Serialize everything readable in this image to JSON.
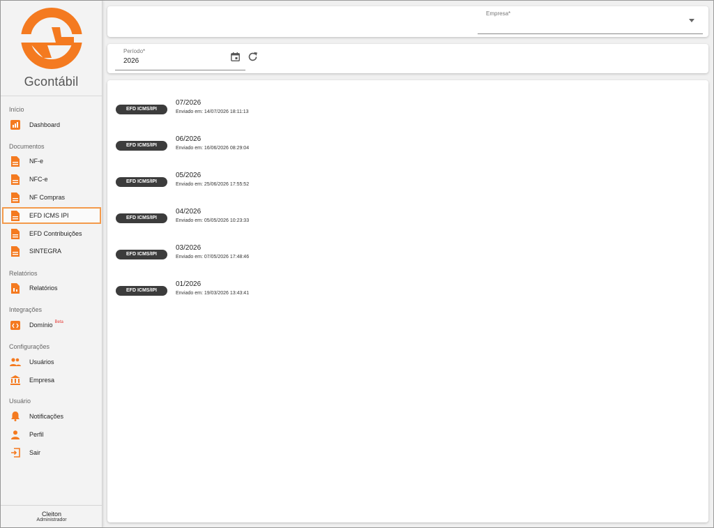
{
  "app": {
    "brand": "Gcontábil",
    "accent_color": "#f47a20"
  },
  "sidebar": {
    "sections": [
      {
        "title": "Início"
      },
      {
        "title": "Documentos"
      },
      {
        "title": "Relatórios"
      },
      {
        "title": "Integrações"
      },
      {
        "title": "Configurações"
      },
      {
        "title": "Usuário"
      }
    ],
    "items": [
      {
        "label": "Dashboard",
        "icon": "chart-icon"
      },
      {
        "label": "NF-e",
        "icon": "document-icon"
      },
      {
        "label": "NFC-e",
        "icon": "document-icon"
      },
      {
        "label": "NF Compras",
        "icon": "document-icon"
      },
      {
        "label": "EFD ICMS IPI",
        "icon": "document-icon",
        "active": true
      },
      {
        "label": "EFD Contribuições",
        "icon": "document-icon"
      },
      {
        "label": "SINTEGRA",
        "icon": "document-icon"
      },
      {
        "label": "Relatórios",
        "icon": "report-icon"
      },
      {
        "label": "Domínio",
        "icon": "code-icon",
        "badge": "Beta"
      },
      {
        "label": "Usuários",
        "icon": "users-icon"
      },
      {
        "label": "Empresa",
        "icon": "bank-icon"
      },
      {
        "label": "Notificações",
        "icon": "bell-icon"
      },
      {
        "label": "Perfil",
        "icon": "person-icon"
      },
      {
        "label": "Sair",
        "icon": "exit-icon"
      }
    ],
    "user": {
      "name": "Cleiton",
      "role": "Administrador"
    }
  },
  "filters": {
    "empresa": {
      "label": "Empresa*",
      "value": ""
    },
    "periodo": {
      "label": "Período*",
      "value": "2026"
    }
  },
  "entries": [
    {
      "chip": "EFD ICMS/IPI",
      "period": "07/2026",
      "sent": "Enviado em: 14/07/2026 18:11:13"
    },
    {
      "chip": "EFD ICMS/IPI",
      "period": "06/2026",
      "sent": "Enviado em: 16/06/2026 08:29:04"
    },
    {
      "chip": "EFD ICMS/IPI",
      "period": "05/2026",
      "sent": "Enviado em: 25/06/2026 17:55:52"
    },
    {
      "chip": "EFD ICMS/IPI",
      "period": "04/2026",
      "sent": "Enviado em: 05/05/2026 10:23:33"
    },
    {
      "chip": "EFD ICMS/IPI",
      "period": "03/2026",
      "sent": "Enviado em: 07/05/2026 17:48:46"
    },
    {
      "chip": "EFD ICMS/IPI",
      "period": "01/2026",
      "sent": "Enviado em: 19/03/2026 13:43:41"
    }
  ]
}
